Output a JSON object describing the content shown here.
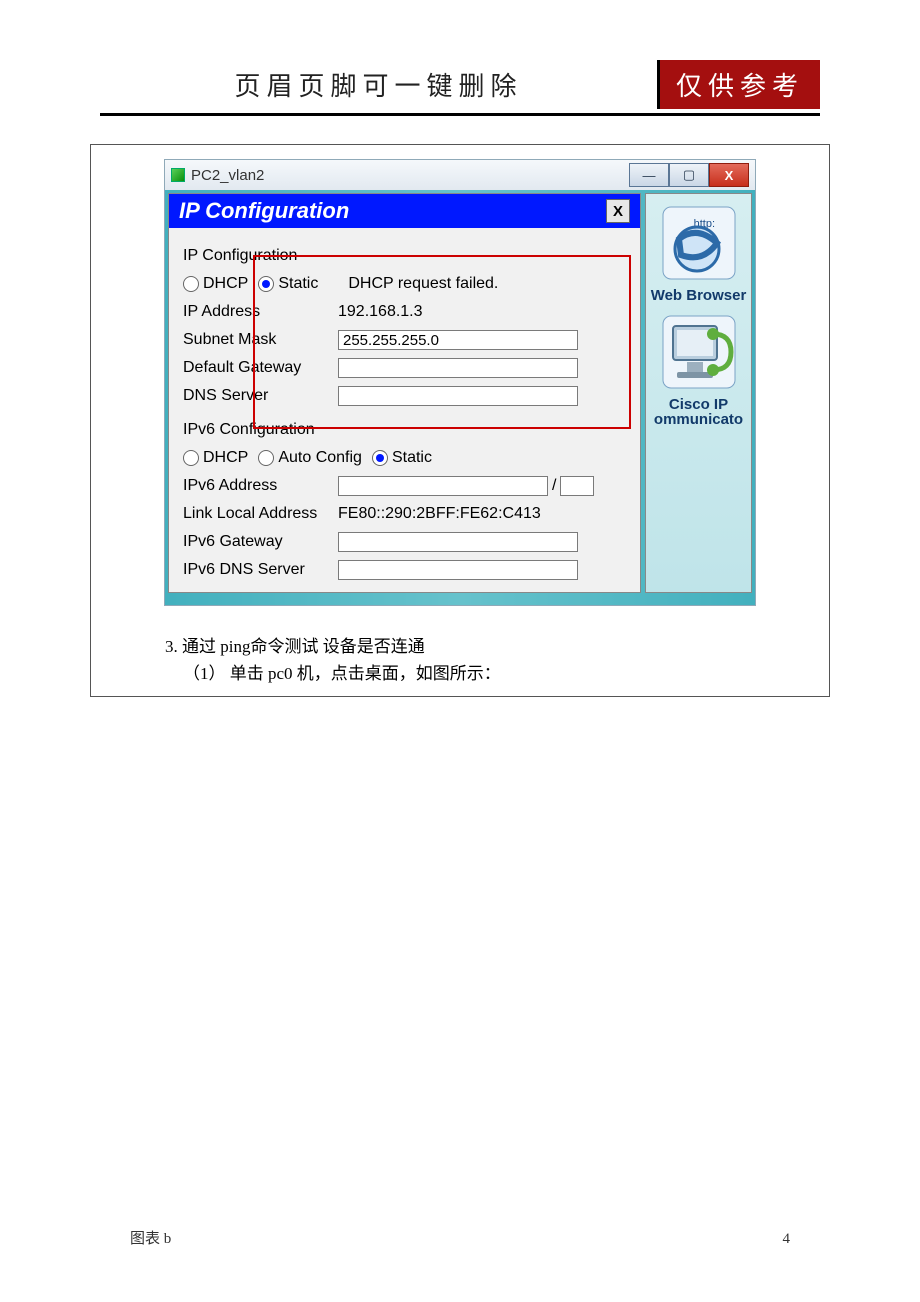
{
  "header": {
    "title_main": "页眉页脚可一键删除",
    "badge": "仅供参考"
  },
  "window": {
    "title": "PC2_vlan2"
  },
  "panel": {
    "title": "IP Configuration",
    "ipv4": {
      "section_label": "IP Configuration",
      "dhcp_label": "DHCP",
      "static_label": "Static",
      "mode_selected": "Static",
      "status_msg": "DHCP request failed.",
      "ip_label": "IP Address",
      "ip_value": "192.168.1.3",
      "mask_label": "Subnet Mask",
      "mask_value": "255.255.255.0",
      "gw_label": "Default Gateway",
      "gw_value": "",
      "dns_label": "DNS Server",
      "dns_value": ""
    },
    "ipv6": {
      "section_label": "IPv6 Configuration",
      "dhcp_label": "DHCP",
      "auto_label": "Auto Config",
      "static_label": "Static",
      "mode_selected": "Static",
      "addr_label": "IPv6 Address",
      "addr_value": "",
      "prefix_value": "",
      "lla_label": "Link Local Address",
      "lla_value": "FE80::290:2BFF:FE62:C413",
      "gw_label": "IPv6 Gateway",
      "gw_value": "",
      "dns_label": "IPv6 DNS Server",
      "dns_value": ""
    }
  },
  "apps": {
    "web_label": "Web Browser",
    "ipcomm_label": "Cisco IP ommunicato",
    "http_tag": "http:"
  },
  "captions": {
    "line1": "3. 通过 ping命令测试 设备是否连通",
    "line2": "（1） 单击 pc0 机，点击桌面，如图所示："
  },
  "footer": {
    "left": "图表 b",
    "right": "4"
  }
}
